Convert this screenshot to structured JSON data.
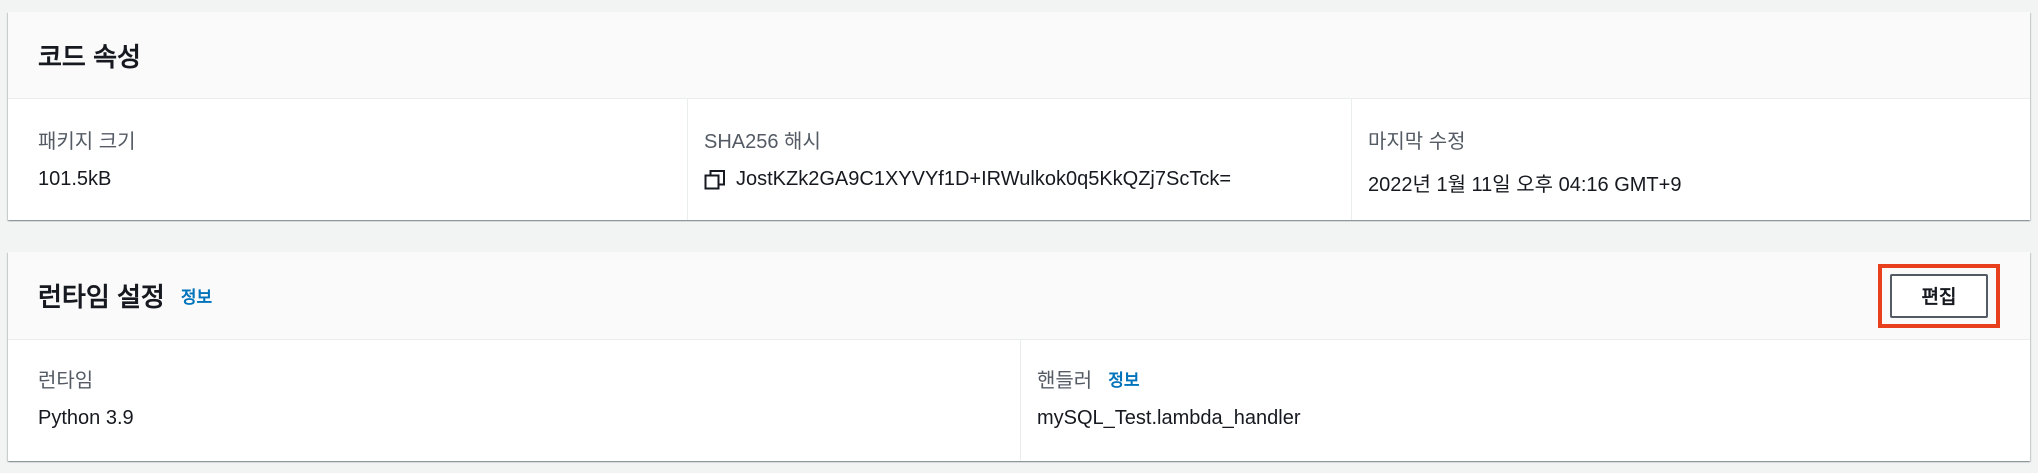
{
  "code_properties": {
    "title": "코드 속성",
    "package_size_label": "패키지 크기",
    "package_size_value": "101.5kB",
    "sha_label": "SHA256 해시",
    "sha_value": "JostKZk2GA9C1XYVYf1D+IRWulkok0q5KkQZj7ScTck=",
    "last_modified_label": "마지막 수정",
    "last_modified_value": "2022년 1월 11일 오후 04:16 GMT+9"
  },
  "runtime_settings": {
    "title": "런타임 설정",
    "info_link": "정보",
    "edit_button": "편집",
    "runtime_label": "런타임",
    "runtime_value": "Python 3.9",
    "handler_label": "핸들러",
    "handler_info_link": "정보",
    "handler_value": "mySQL_Test.lambda_handler"
  },
  "icons": {
    "copy": "copy-icon"
  },
  "colors": {
    "link": "#0073bb",
    "highlight": "#e8401c"
  }
}
